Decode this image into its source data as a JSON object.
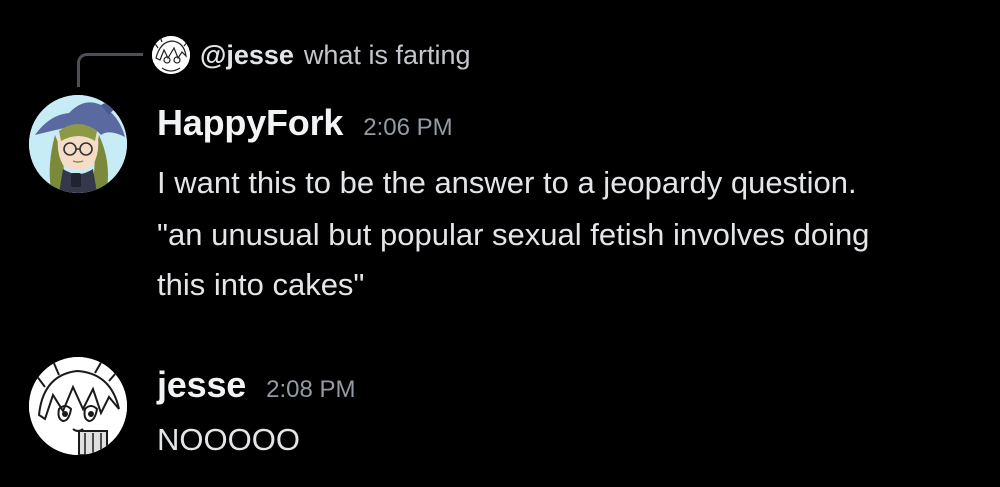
{
  "reply": {
    "author": "@jesse",
    "text": "what is farting"
  },
  "messages": [
    {
      "author": "HappyFork",
      "timestamp": "2:06 PM",
      "lines": [
        "I want this to be the answer to a jeopardy question.",
        "\"an unusual but popular sexual fetish involves doing",
        "this into cakes\""
      ],
      "avatar_icon": "witch-girl-avatar"
    },
    {
      "author": "jesse",
      "timestamp": "2:08 PM",
      "lines": [
        "NOOOOO"
      ],
      "avatar_icon": "manga-girl-avatar"
    }
  ],
  "colors": {
    "background": "#000000",
    "author": "#f2f3f5",
    "message_text": "#e3e5e8",
    "timestamp": "#949ba4",
    "reply_spine": "#4e5058"
  }
}
